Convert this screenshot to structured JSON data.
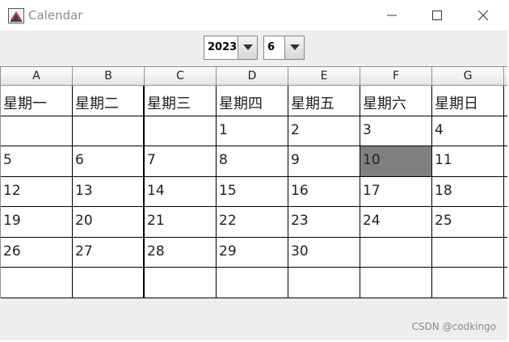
{
  "window": {
    "title": "Calendar",
    "controls": {
      "minimize": "minimize-icon",
      "maximize": "maximize-icon",
      "close": "close-icon"
    }
  },
  "year_select": {
    "value": "2023"
  },
  "month_select": {
    "value": "6"
  },
  "table": {
    "column_headers": [
      "A",
      "B",
      "C",
      "D",
      "E",
      "F",
      "G"
    ],
    "weekdays": [
      "星期一",
      "星期二",
      "星期三",
      "星期四",
      "星期五",
      "星期六",
      "星期日"
    ],
    "rows": [
      [
        "",
        "",
        "",
        "1",
        "2",
        "3",
        "4"
      ],
      [
        "5",
        "6",
        "7",
        "8",
        "9",
        "10",
        "11"
      ],
      [
        "12",
        "13",
        "14",
        "15",
        "16",
        "17",
        "18"
      ],
      [
        "19",
        "20",
        "21",
        "22",
        "23",
        "24",
        "25"
      ],
      [
        "26",
        "27",
        "28",
        "29",
        "30",
        "",
        ""
      ],
      [
        "",
        "",
        "",
        "",
        "",
        "",
        ""
      ]
    ],
    "selected_day": "10",
    "selected_color": "#808080"
  },
  "watermark": "CSDN @codkingo"
}
